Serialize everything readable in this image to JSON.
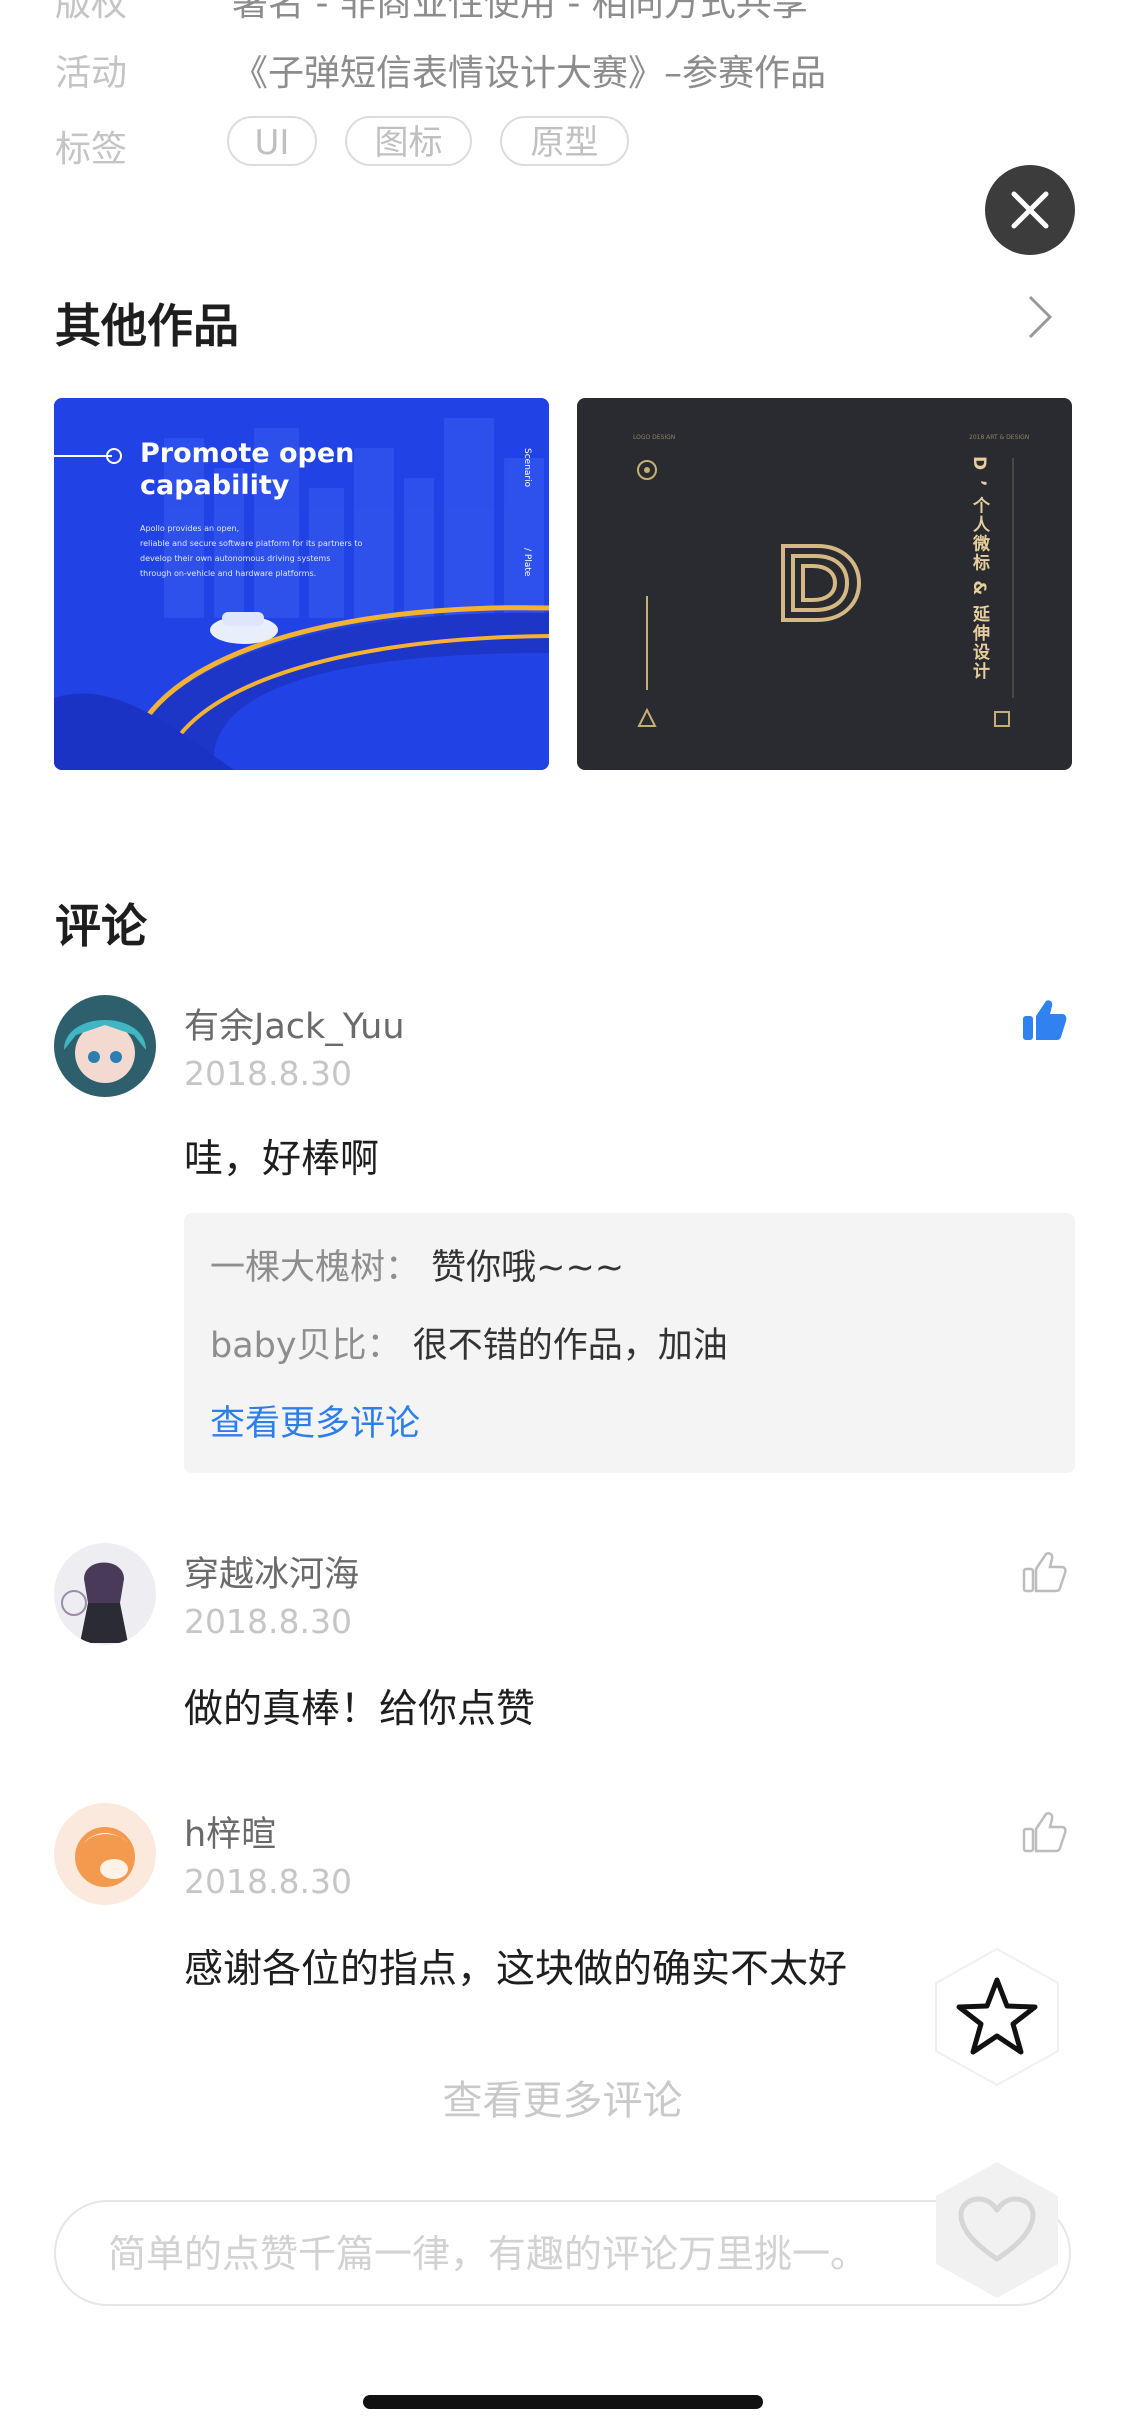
{
  "meta": {
    "top_cut_label": "版权",
    "top_cut_value": "署名 - 非商业性使用 - 相同方式共享",
    "activity_label": "活动",
    "activity_value": "《子弹短信表情设计大赛》–参赛作品",
    "tags_label": "标签",
    "tags": [
      "UI",
      "图标",
      "原型"
    ]
  },
  "other_works": {
    "title": "其他作品",
    "blue_card": {
      "heading_line1": "Promote open",
      "heading_line2": "capability",
      "body_lines": [
        "Apollo provides an open,",
        "reliable and secure software platform for its partners to",
        "develop their own autonomous driving systems",
        "through on-vehicle and hardware platforms."
      ],
      "side_text_1": "Scenario",
      "side_text_2": "/ Plate"
    },
    "dark_card": {
      "vertical_title": "D ’ 个人微标 & 延伸设计",
      "small_text_left": "LOGO DESIGN",
      "small_text_right": "2018 ART & DESIGN"
    }
  },
  "comments_section": {
    "title": "评论",
    "comments": [
      {
        "name": "有余Jack_Yuu",
        "date": "2018.8.30",
        "text": "哇，好棒啊",
        "liked": true,
        "replies": [
          {
            "author": "一棵大槐树：",
            "body": "赞你哦~~~"
          },
          {
            "author": "baby贝比：",
            "body": "很不错的作品，加油"
          }
        ],
        "more_replies": "查看更多评论"
      },
      {
        "name": "穿越冰河海",
        "date": "2018.8.30",
        "text": "做的真棒！给你点赞",
        "liked": false
      },
      {
        "name": "h梓暄",
        "date": "2018.8.30",
        "text": "感谢各位的指点，这块做的确实不太好",
        "liked": false
      }
    ],
    "more_comments": "查看更多评论"
  },
  "input": {
    "placeholder": "简单的点赞千篇一律，有趣的评论万里挑一。"
  },
  "colors": {
    "accent_blue": "#2d7ee8",
    "like_active": "#2f82f0",
    "close_bg": "#3c3c3c"
  }
}
